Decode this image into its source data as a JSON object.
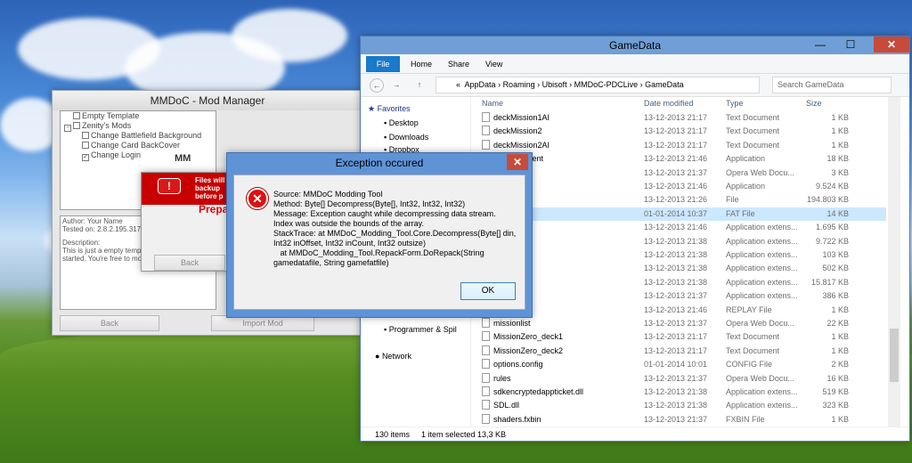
{
  "mod_manager": {
    "title": "MMDoC - Mod Manager",
    "tree": [
      "Empty Template",
      "Zenity's Mods",
      "Change Battlefield Background",
      "Change Card BackCover",
      "Change Login"
    ],
    "info": [
      "Author: Your Name",
      "Tested on: 2.8.2.195.3173",
      "",
      "Description:",
      "This is just a empty templat",
      "started. You're free to moo"
    ],
    "back": "Back",
    "import": "Import Mod"
  },
  "progress": {
    "title_partial": "MM",
    "header": "Files will\nbackup\nbefore p",
    "status": "Prepa",
    "back": "Back"
  },
  "explorer": {
    "title": "GameData",
    "minimize": "—",
    "maximize": "☐",
    "close": "✕",
    "ribbon": {
      "file": "File",
      "home": "Home",
      "share": "Share",
      "view": "View"
    },
    "path": [
      "«",
      "AppData",
      "Roaming",
      "Ubisoft",
      "MMDoC-PDCLive",
      "GameData"
    ],
    "search_placeholder": "Search GameData",
    "nav": {
      "favorites": "Favorites",
      "desktop": "Desktop",
      "downloads": "Downloads",
      "dropbox": "Dropbox",
      "programmer": "Programmer & Spil",
      "network": "Network"
    },
    "columns": {
      "name": "Name",
      "date": "Date modified",
      "type": "Type",
      "size": "Size"
    },
    "files": [
      {
        "name": "deckMission1AI",
        "date": "13-12-2013 21:17",
        "type": "Text Document",
        "size": "1 KB"
      },
      {
        "name": "deckMission2",
        "date": "13-12-2013 21:17",
        "type": "Text Document",
        "size": "1 KB"
      },
      {
        "name": "deckMission2AI",
        "date": "13-12-2013 21:17",
        "type": "Text Document",
        "size": "1 KB"
      },
      {
        "name": "kRequirement",
        "date": "13-12-2013 21:46",
        "type": "Application",
        "size": "18 KB"
      },
      {
        "name": "",
        "date": "13-12-2013 21:37",
        "type": "Opera Web Docu...",
        "size": "3 KB"
      },
      {
        "name": "",
        "date": "13-12-2013 21:46",
        "type": "Application",
        "size": "9.524 KB"
      },
      {
        "name": "",
        "date": "13-12-2013 21:26",
        "type": "File",
        "size": "194.803 KB"
      },
      {
        "name": "at",
        "date": "01-01-2014 10:37",
        "type": "FAT File",
        "size": "14 KB"
      },
      {
        "name": "brary.dll",
        "date": "13-12-2013 21:46",
        "type": "Application extens...",
        "size": "1.695 KB"
      },
      {
        "name": "",
        "date": "13-12-2013 21:38",
        "type": "Application extens...",
        "size": "9.722 KB"
      },
      {
        "name": "",
        "date": "13-12-2013 21:38",
        "type": "Application extens...",
        "size": "103 KB"
      },
      {
        "name": "l",
        "date": "13-12-2013 21:38",
        "type": "Application extens...",
        "size": "502 KB"
      },
      {
        "name": "dll",
        "date": "13-12-2013 21:38",
        "type": "Application extens...",
        "size": "15.817 KB"
      },
      {
        "name": "ttv.dll",
        "date": "13-12-2013 21:37",
        "type": "Application extens...",
        "size": "386 KB"
      },
      {
        "name": "play",
        "date": "13-12-2013 21:46",
        "type": "REPLAY File",
        "size": "1 KB"
      },
      {
        "name": "missionlist",
        "date": "13-12-2013 21:37",
        "type": "Opera Web Docu...",
        "size": "22 KB"
      },
      {
        "name": "MissionZero_deck1",
        "date": "13-12-2013 21:17",
        "type": "Text Document",
        "size": "1 KB"
      },
      {
        "name": "MissionZero_deck2",
        "date": "13-12-2013 21:17",
        "type": "Text Document",
        "size": "1 KB"
      },
      {
        "name": "options.config",
        "date": "01-01-2014 10:01",
        "type": "CONFIG File",
        "size": "2 KB"
      },
      {
        "name": "rules",
        "date": "13-12-2013 21:37",
        "type": "Opera Web Docu...",
        "size": "16 KB"
      },
      {
        "name": "sdkencryptedappticket.dll",
        "date": "13-12-2013 21:38",
        "type": "Application extens...",
        "size": "519 KB"
      },
      {
        "name": "SDL.dll",
        "date": "13-12-2013 21:38",
        "type": "Application extens...",
        "size": "323 KB"
      },
      {
        "name": "shaders.fxbin",
        "date": "13-12-2013 21:37",
        "type": "FXBIN File",
        "size": "1 KB"
      }
    ],
    "status_items": "130 items",
    "status_selected": "1 item selected  13,3 KB"
  },
  "dialog": {
    "title": "Exception occured",
    "message": "Source: MMDoC Modding Tool\nMethod: Byte[] Decompress(Byte[], Int32, Int32, Int32)\nMessage: Exception caught while decompressing data stream.\nIndex was outside the bounds of the array.\nStackTrace: at MMDoC_Modding_Tool.Core.Decompress(Byte[] din,\nInt32 inOffset, Int32 inCount, Int32 outsize)\n   at MMDoC_Modding_Tool.RepackForm.DoRepack(String\ngamedatafile, String gamefatfile)",
    "ok": "OK"
  }
}
